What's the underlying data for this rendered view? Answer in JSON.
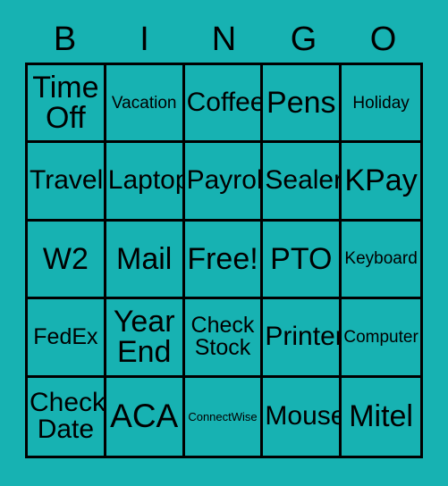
{
  "card": {
    "title": "BINGO",
    "background_color": "#17b2b2",
    "border_color": "#000000",
    "text_color": "#000000"
  },
  "header": {
    "letters": [
      "B",
      "I",
      "N",
      "G",
      "O"
    ]
  },
  "grid": {
    "rows": 5,
    "columns": 5,
    "free_space": "Free!",
    "cells": [
      {
        "text": "Time\nOff",
        "size": "lg"
      },
      {
        "text": "Vacation",
        "size": "xs"
      },
      {
        "text": "Coffee",
        "size": "md"
      },
      {
        "text": "Pens",
        "size": "lg"
      },
      {
        "text": "Holiday",
        "size": "xs"
      },
      {
        "text": "Travel",
        "size": "md"
      },
      {
        "text": "Laptop",
        "size": "md"
      },
      {
        "text": "Payroll",
        "size": "md"
      },
      {
        "text": "Sealer",
        "size": "md"
      },
      {
        "text": "KPay",
        "size": "lg"
      },
      {
        "text": "W2",
        "size": "lg"
      },
      {
        "text": "Mail",
        "size": "lg"
      },
      {
        "text": "Free!",
        "size": "lg"
      },
      {
        "text": "PTO",
        "size": "lg"
      },
      {
        "text": "Keyboard",
        "size": "xs"
      },
      {
        "text": "FedEx",
        "size": "sm"
      },
      {
        "text": "Year\nEnd",
        "size": "lg"
      },
      {
        "text": "Check\nStock",
        "size": "sm"
      },
      {
        "text": "Printer",
        "size": "md"
      },
      {
        "text": "Computer",
        "size": "xs"
      },
      {
        "text": "Check\nDate",
        "size": "md"
      },
      {
        "text": "ACA",
        "size": "xl"
      },
      {
        "text": "ConnectWise",
        "size": "xxs"
      },
      {
        "text": "Mouse",
        "size": "md"
      },
      {
        "text": "Mitel",
        "size": "lg"
      }
    ]
  }
}
